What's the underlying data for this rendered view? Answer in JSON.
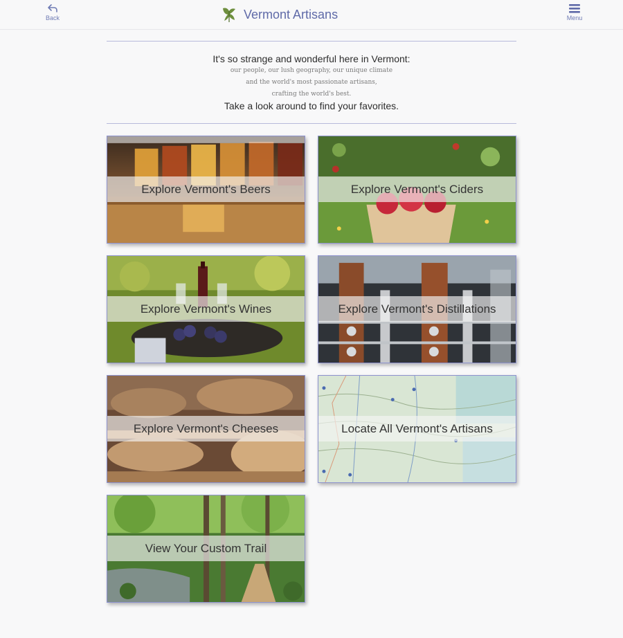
{
  "header": {
    "back_label": "Back",
    "back_icon": "reply-arrow-icon",
    "brand_title": "Vermont Artisans",
    "brand_icon": "leaf-logo-icon",
    "menu_label": "Menu",
    "menu_icon": "hamburger-icon",
    "accent_color": "#5f6aa8"
  },
  "intro": {
    "line1": "It's so strange and wonderful here in Vermont:",
    "line2": "our people, our lush geography, our unique climate",
    "line3": "and the world's most passionate artisans,",
    "line4": "crafting the world's best.",
    "line5": "Take a look around to find your favorites."
  },
  "tiles": [
    {
      "label": "Explore Vermont's Beers"
    },
    {
      "label": "Explore Vermont's Ciders"
    },
    {
      "label": "Explore Vermont's Wines"
    },
    {
      "label": "Explore Vermont's Distillations"
    },
    {
      "label": "Explore Vermont's Cheeses"
    },
    {
      "label": "Locate All Vermont's Artisans"
    },
    {
      "label": "View Your Custom Trail"
    }
  ]
}
